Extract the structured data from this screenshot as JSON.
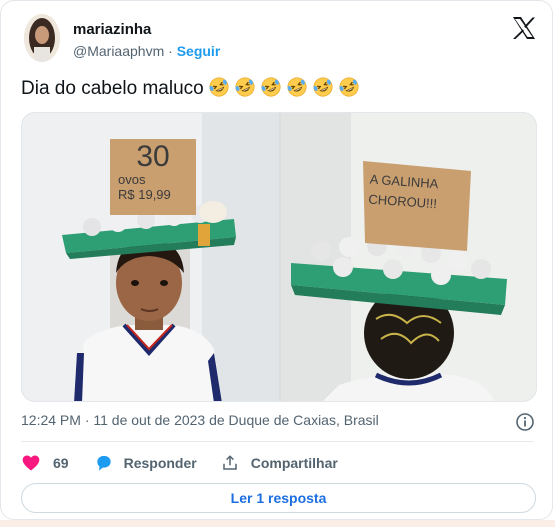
{
  "author": {
    "name": "mariazinha",
    "handle": "@Mariaaphvm",
    "separator": "·",
    "follow_label": "Seguir"
  },
  "tweet": {
    "text": "Dia do cabelo maluco",
    "emoji_count": 6,
    "emoji_name": "rolling-on-the-floor-laughing-emoji"
  },
  "photos": {
    "left_sign": {
      "line1": "30",
      "line2": "ovos",
      "line3": "R$ 19,99"
    },
    "right_sign": {
      "line1": "A GALINHA",
      "line2": "CHOROU!!!"
    }
  },
  "meta": {
    "text": "12:24 PM · 11 de out de 2023 de Duque de Caxias, Brasil"
  },
  "actions": {
    "like_count": "69",
    "reply_label": "Responder",
    "share_label": "Compartilhar"
  },
  "read_replies_label": "Ler 1 resposta",
  "colors": {
    "accent": "#1d9bf0",
    "like": "#f91880",
    "reply_icon": "#1d9bf0",
    "muted": "#536471",
    "carton": "#2e9e74"
  }
}
